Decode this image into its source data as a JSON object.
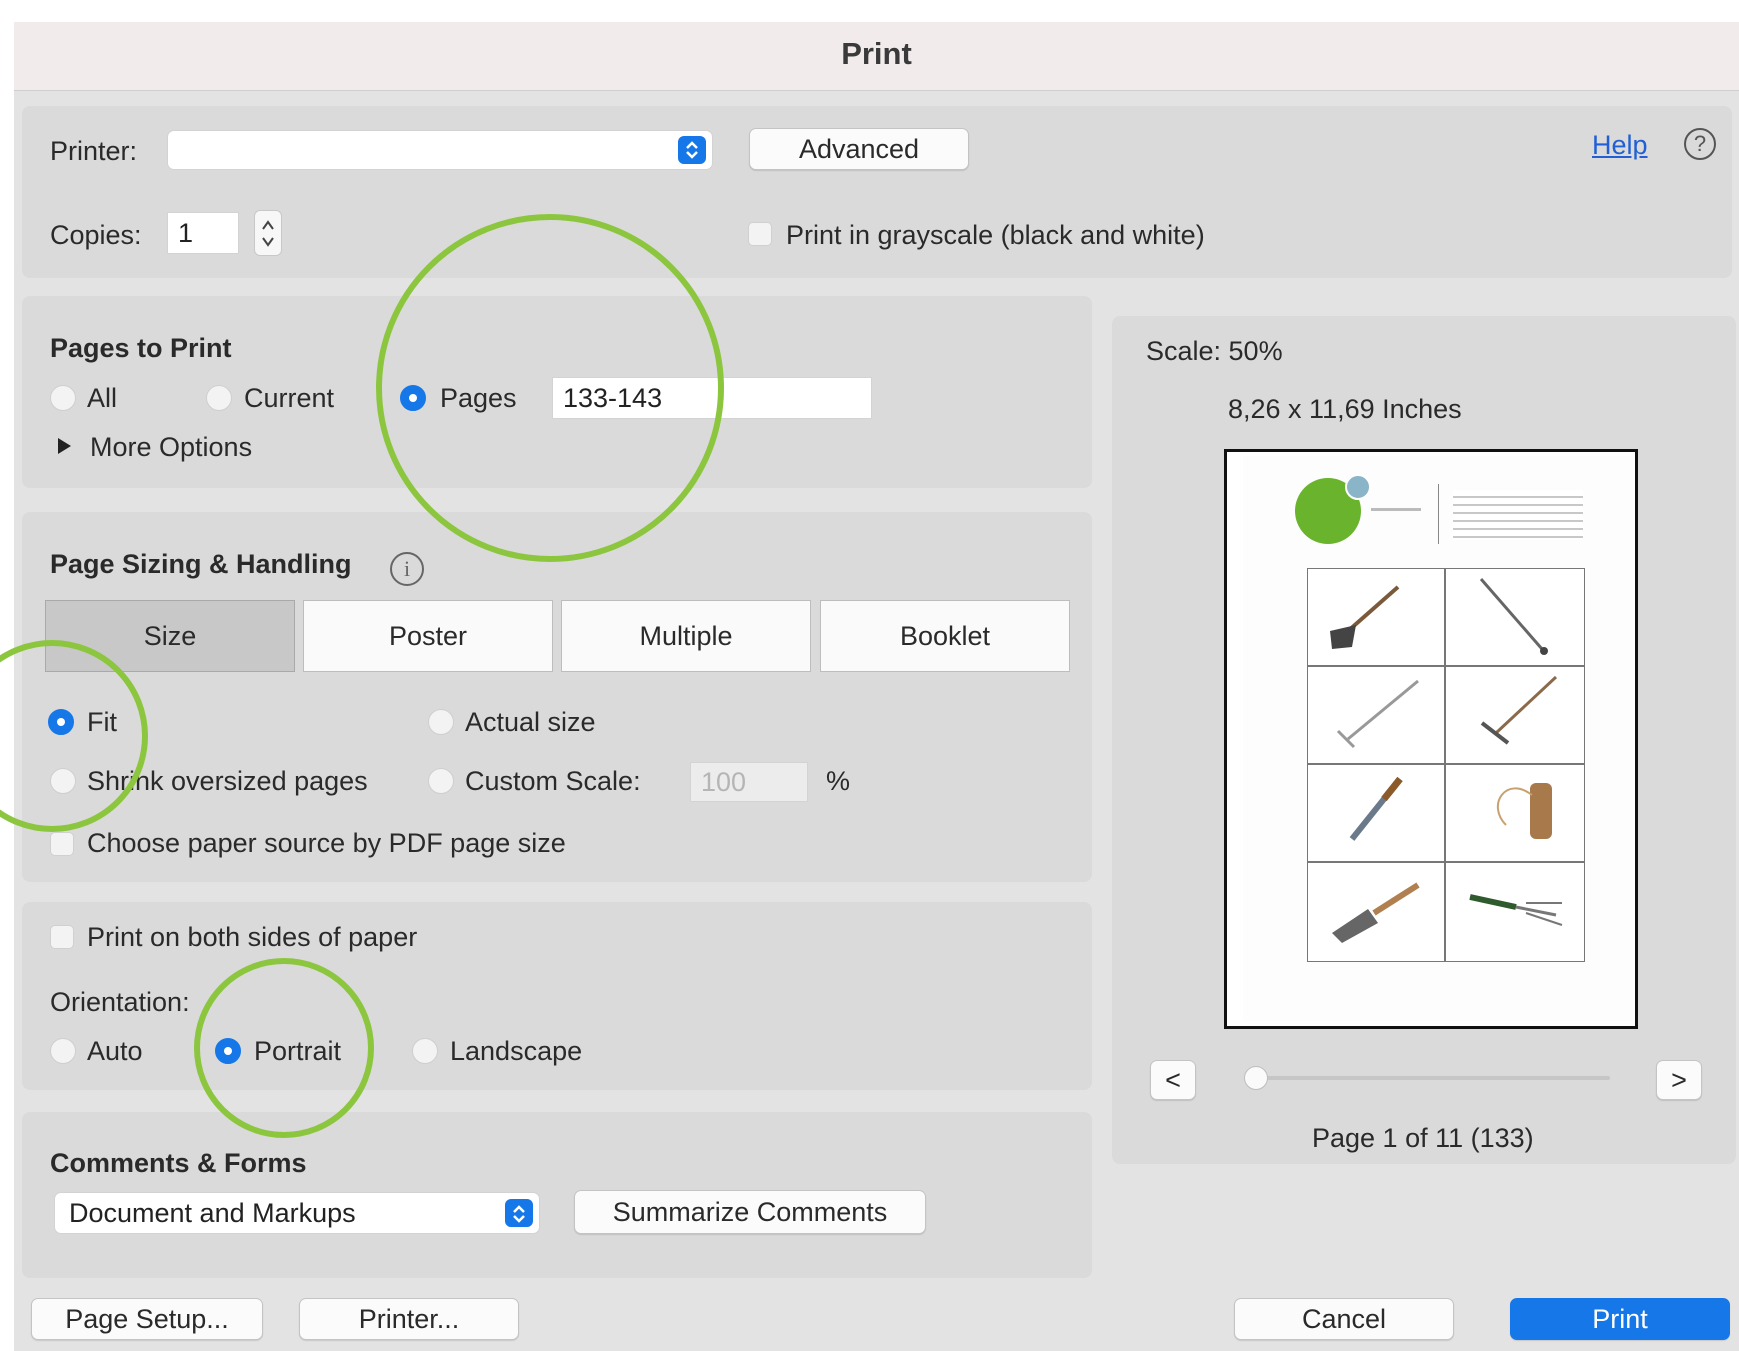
{
  "window": {
    "title": "Print"
  },
  "printer": {
    "label": "Printer:",
    "value": "",
    "advanced_label": "Advanced",
    "help_label": "Help"
  },
  "copies": {
    "label": "Copies:",
    "value": "1"
  },
  "grayscale": {
    "label": "Print in grayscale (black and white)",
    "checked": false
  },
  "pages_to_print": {
    "heading": "Pages to Print",
    "options": [
      "All",
      "Current",
      "Pages"
    ],
    "selected": "Pages",
    "range_value": "133-143",
    "more_options_label": "More Options"
  },
  "page_sizing": {
    "heading": "Page Sizing & Handling",
    "tabs": [
      "Size",
      "Poster",
      "Multiple",
      "Booklet"
    ],
    "selected_tab": "Size",
    "fit_label": "Fit",
    "actual_size_label": "Actual size",
    "shrink_label": "Shrink oversized pages",
    "custom_scale_label": "Custom Scale:",
    "custom_scale_value": "100",
    "percent_label": "%",
    "paper_source_label": "Choose paper source by PDF page size",
    "selected": "Fit"
  },
  "sides": {
    "both_sides_label": "Print on both sides of paper"
  },
  "orientation": {
    "label": "Orientation:",
    "options": [
      "Auto",
      "Portrait",
      "Landscape"
    ],
    "selected": "Portrait"
  },
  "comments_forms": {
    "heading": "Comments & Forms",
    "value": "Document and Markups",
    "summarize_label": "Summarize Comments"
  },
  "preview": {
    "scale_text": "Scale:  50%",
    "size_text": "8,26 x 11,69 Inches",
    "prev_label": "<",
    "next_label": ">",
    "page_text": "Page 1 of 11 (133)",
    "slider_position": 0
  },
  "footer": {
    "page_setup_label": "Page Setup...",
    "printer_label": "Printer...",
    "cancel_label": "Cancel",
    "print_label": "Print"
  },
  "colors": {
    "accent": "#1677e8",
    "highlight_circle": "#8cc63f",
    "logo_green": "#6ab42d"
  }
}
